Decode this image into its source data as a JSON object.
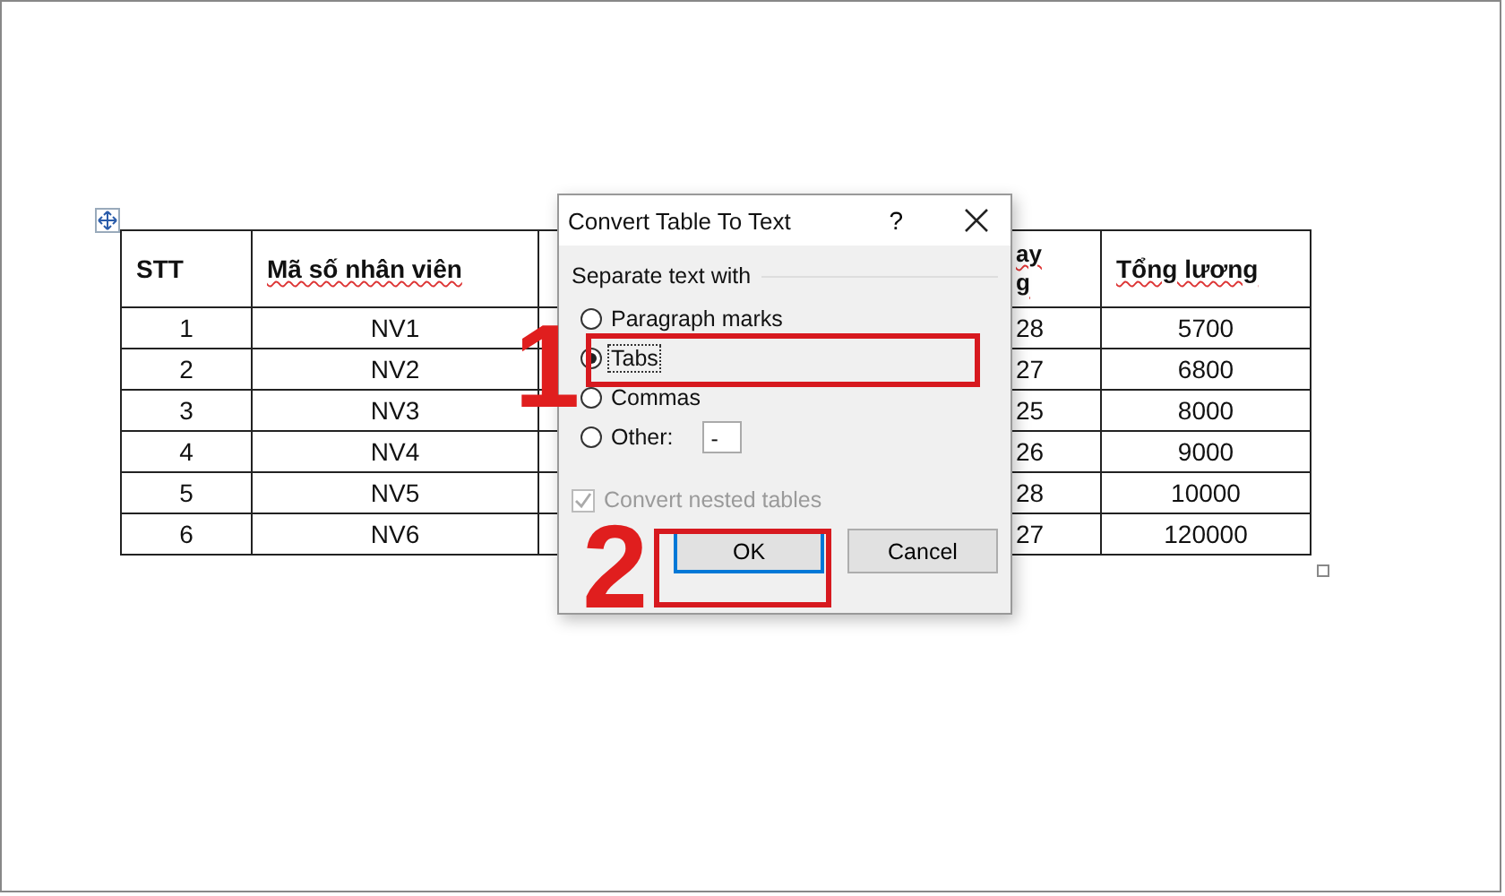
{
  "document": {
    "table": {
      "columns": [
        {
          "lines": [
            "STT"
          ],
          "misspelled": false
        },
        {
          "lines": [
            "Mã số nhân viên"
          ],
          "misspelled": true
        },
        {
          "lines": [
            "ay",
            "g"
          ],
          "misspelled": true
        },
        {
          "lines": [
            "Tổng lương"
          ],
          "misspelled": true
        }
      ],
      "rows": [
        [
          "1",
          "NV1",
          "28",
          "5700"
        ],
        [
          "2",
          "NV2",
          "27",
          "6800"
        ],
        [
          "3",
          "NV3",
          "25",
          "8000"
        ],
        [
          "4",
          "NV4",
          "26",
          "9000"
        ],
        [
          "5",
          "NV5",
          "28",
          "10000"
        ],
        [
          "6",
          "NV6",
          "27",
          "120000"
        ]
      ]
    }
  },
  "dialog": {
    "title": "Convert Table To Text",
    "help": "?",
    "section": "Separate text with",
    "options": [
      {
        "kind": "radio",
        "label": "Paragraph marks",
        "selected": false,
        "focused": false
      },
      {
        "kind": "radio",
        "label": "Tabs",
        "selected": true,
        "focused": true
      },
      {
        "kind": "radio",
        "label": "Commas",
        "selected": false,
        "focused": false
      },
      {
        "kind": "other",
        "label": "Other:",
        "selected": false,
        "focused": false
      }
    ],
    "other_field": {
      "value": "-"
    },
    "checkbox": {
      "label": "Convert nested tables",
      "checked": true,
      "disabled": true
    },
    "buttons": [
      {
        "label": "OK",
        "default": true
      },
      {
        "label": "Cancel",
        "default": false
      }
    ]
  },
  "annotations": [
    {
      "label": "1"
    },
    {
      "label": "2"
    }
  ]
}
